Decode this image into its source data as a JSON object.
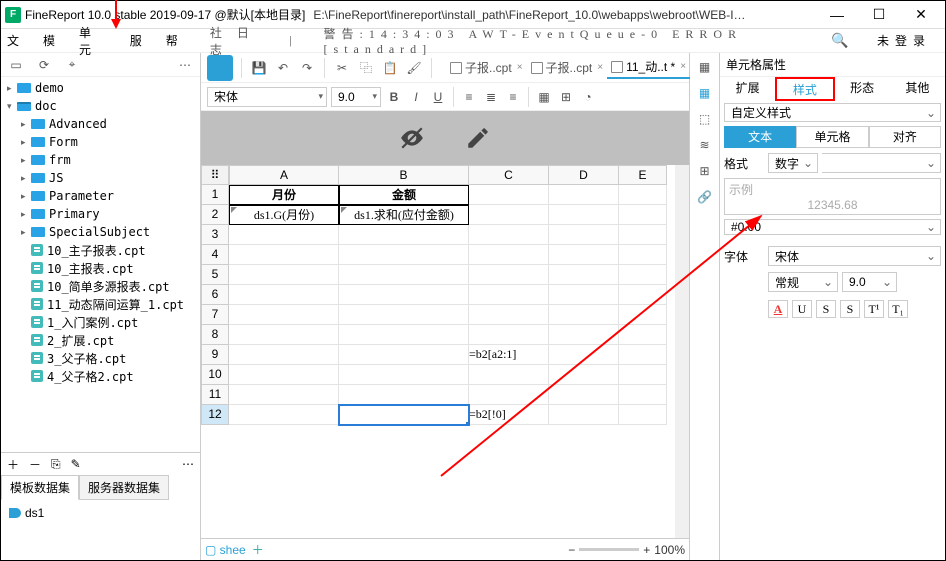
{
  "title": "FineReport 10.0 stable 2019-09-17 @默认[本地目录]",
  "path": "E:\\FineReport\\finereport\\install_path\\FineReport_10.0\\webapps\\webroot\\WEB-I…",
  "win": {
    "min": "—",
    "max": "☐",
    "close": "✕"
  },
  "menu": [
    "文",
    "模",
    "单元",
    "服",
    "帮"
  ],
  "logprefix": "社 日志",
  "logline": "警告:14:34:03 AWT-EventQueue-0 ERROR [standard]",
  "login": "未登录",
  "tree": {
    "demo": "demo",
    "doc": "doc",
    "folders": [
      "Advanced",
      "Form",
      "frm",
      "JS",
      "Parameter",
      "Primary",
      "SpecialSubject"
    ],
    "files": [
      "10_主子报表.cpt",
      "10_主报表.cpt",
      "10_简单多源报表.cpt",
      "11_动态隔间运算_1.cpt",
      "1_入门案例.cpt",
      "2_扩展.cpt",
      "3_父子格.cpt",
      "4_父子格2.cpt"
    ]
  },
  "dstabs": {
    "a": "模板数据集",
    "b": "服务器数据集"
  },
  "ds1": "ds1",
  "filetabs": [
    {
      "label": "子报..cpt"
    },
    {
      "label": "子报..cpt"
    },
    {
      "label": "11_动..t *",
      "active": true
    }
  ],
  "font": {
    "name": "宋体",
    "size": "9.0"
  },
  "cols": [
    "A",
    "B",
    "C",
    "D",
    "E"
  ],
  "cells": {
    "a1": "月份",
    "b1": "金额",
    "a2": "ds1.G(月份)",
    "b2": "ds1.求和(应付金额)",
    "c9": "=b2[a2:1]",
    "c12": "=b2[!0]"
  },
  "sheet": "shee",
  "zoom": "100%",
  "right": {
    "title": "单元格属性",
    "tabs": [
      "扩展",
      "样式",
      "形态",
      "其他"
    ],
    "custom": "自定义样式",
    "sub": [
      "文本",
      "单元格",
      "对齐"
    ],
    "format_label": "格式",
    "format_value": "数字",
    "example_label": "示例",
    "example_value": "12345.68",
    "pattern": "#0.00",
    "font_label": "字体",
    "font_name": "宋体",
    "font_style": "常规",
    "font_size": "9.0",
    "tools": [
      "A",
      "U",
      "S",
      "S",
      "T¹",
      "T₁"
    ]
  }
}
